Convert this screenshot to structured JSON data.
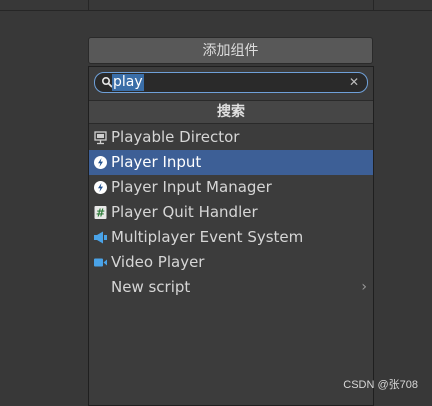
{
  "add_component": {
    "label": "添加组件"
  },
  "search": {
    "value": "play"
  },
  "results_header": "搜索",
  "items": [
    {
      "label": "Playable Director",
      "icon": "playable-director-icon",
      "selected": false
    },
    {
      "label": "Player Input",
      "icon": "player-input-icon",
      "selected": true
    },
    {
      "label": "Player Input Manager",
      "icon": "player-input-manager-icon",
      "selected": false
    },
    {
      "label": "Player Quit Handler",
      "icon": "script-icon",
      "selected": false
    },
    {
      "label": "Multiplayer Event System",
      "icon": "event-system-icon",
      "selected": false
    },
    {
      "label": "Video Player",
      "icon": "video-player-icon",
      "selected": false
    },
    {
      "label": "New script",
      "icon": "",
      "selected": false,
      "has_submenu": true
    }
  ],
  "submenu_arrow": "›",
  "watermark": "CSDN @张708",
  "colors": {
    "selection": "#3d5f96",
    "search_highlight": "#3a6ea8",
    "search_border": "#6fa0d8",
    "background": "#383838"
  }
}
